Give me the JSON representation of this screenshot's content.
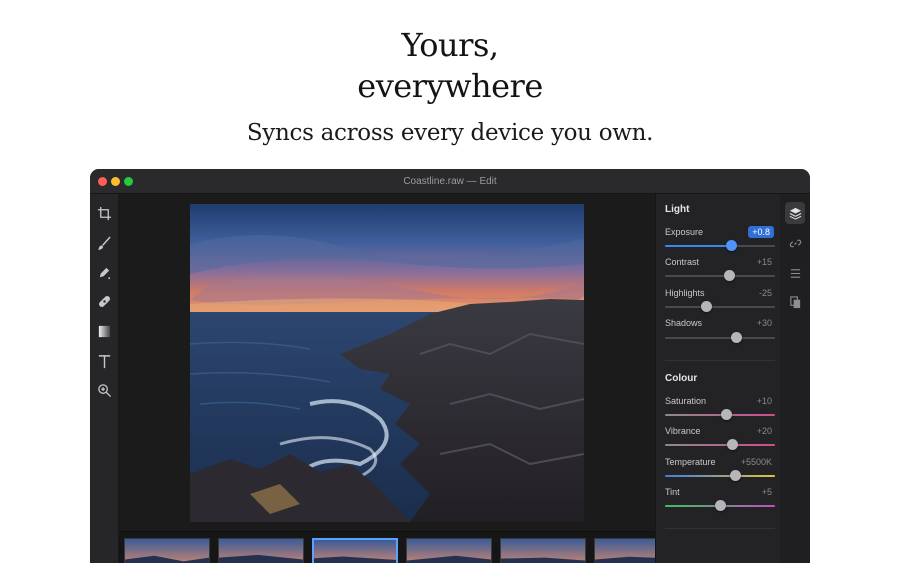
{
  "hero": {
    "line1": "Yours,",
    "line2": "everywhere",
    "subtitle": "Syncs across every device you own."
  },
  "window": {
    "title": "Coastline.raw — Edit"
  },
  "toolbar": {
    "tools": [
      "crop-icon",
      "brush-icon",
      "pen-icon",
      "healing-icon",
      "gradient-icon",
      "text-icon",
      "zoom-icon"
    ]
  },
  "panel": {
    "light": {
      "title": "Light",
      "adjustments": [
        {
          "label": "Exposure",
          "value": "+0.8",
          "level": 0.6
        },
        {
          "label": "Contrast",
          "value": "+15",
          "level": 0.58
        },
        {
          "label": "Highlights",
          "value": "-25",
          "level": 0.37
        },
        {
          "label": "Shadows",
          "value": "+30",
          "level": 0.65
        }
      ]
    },
    "colour": {
      "title": "Colour",
      "adjustments": [
        {
          "label": "Saturation",
          "value": "+10",
          "level": 0.55
        },
        {
          "label": "Vibrance",
          "value": "+20",
          "level": 0.61
        },
        {
          "label": "Temperature",
          "value": "+5500K",
          "level": 0.64
        },
        {
          "label": "Tint",
          "value": "+5",
          "level": 0.5
        }
      ]
    }
  },
  "rail": {
    "icons": [
      "layers-icon",
      "link-icon",
      "list-icon",
      "copy-icon"
    ],
    "active": "layers-icon"
  },
  "filmstrip": {
    "count": 6,
    "selected_index": 2
  },
  "colors": {
    "accent": "#3d86f0",
    "window_bg": "#1e1e1f",
    "panel_bg": "#232325"
  }
}
